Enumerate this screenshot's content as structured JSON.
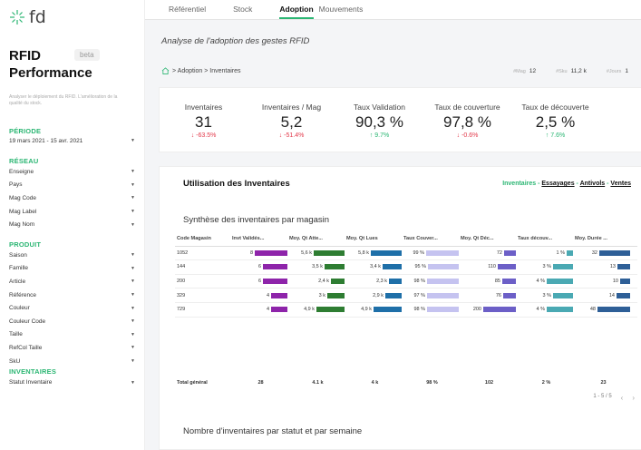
{
  "app": {
    "logo": "fd",
    "title_line1": "RFID",
    "title_line2": "Performance",
    "beta": "beta",
    "description": "Analyser le déploiement du RFID. L'amélioration de la qualité du stock."
  },
  "sidebar": {
    "periode": {
      "title": "PÉRIODE",
      "value": "19 mars 2021 - 15 avr. 2021"
    },
    "reseau": {
      "title": "RÉSEAU",
      "items": [
        "Enseigne",
        "Pays",
        "Mag Code",
        "Mag Label",
        "Mag Nom"
      ]
    },
    "produit": {
      "title": "PRODUIT",
      "items": [
        "Saison",
        "Famille",
        "Article",
        "Référence",
        "Couleur",
        "Couleur Code",
        "Taille",
        "RefCol Taille",
        "SkU"
      ]
    },
    "inventaires": {
      "title": "INVENTAIRES",
      "items": [
        "Statut Inventaire"
      ]
    }
  },
  "tabs": [
    "Référentiel",
    "Stock",
    "Adoption",
    "Mouvements"
  ],
  "subtitle": "Analyse de l'adoption des gestes RFID",
  "breadcrumb": "> Adoption > Inventaires",
  "stats": [
    {
      "label": "#Mag",
      "value": "12"
    },
    {
      "label": "#Sku",
      "value": "11,2 k"
    },
    {
      "label": "#Jours",
      "value": "1"
    }
  ],
  "kpis": [
    {
      "label": "Inventaires",
      "value": "31",
      "delta": "↓ -63.5%",
      "dir": "neg"
    },
    {
      "label": "Inventaires / Mag",
      "value": "5,2",
      "delta": "↓ -51.4%",
      "dir": "neg"
    },
    {
      "label": "Taux Validation",
      "value": "90,3 %",
      "delta": "↑ 9.7%",
      "dir": "pos"
    },
    {
      "label": "Taux de couverture",
      "value": "97,8 %",
      "delta": "↓ -0.6%",
      "dir": "neg"
    },
    {
      "label": "Taux de découverte",
      "value": "2,5 %",
      "delta": "↑ 7.6%",
      "dir": "pos"
    }
  ],
  "panel": {
    "title": "Utilisation des Inventaires",
    "links": {
      "current": "Inventaires",
      "others": [
        "Essayages",
        "Antivols",
        "Ventes"
      ]
    },
    "table_title": "Synthèse des inventaires par magasin",
    "columns": [
      "Code Magasin",
      "Invt Validés...",
      "Moy. Qt Atte...",
      "Moy. Qt Lues",
      "Taux Couver...",
      "Moy. Qt Déc...",
      "Taux découv...",
      "Moy. Durée ..."
    ],
    "bar_colors": [
      "#8e24aa",
      "#2e7d32",
      "#1e6fa8",
      "#c5c3f0",
      "#6c5fc7",
      "#4aa9b3",
      "#2e5f97"
    ],
    "rows": [
      {
        "code": "1052",
        "cells": [
          "8",
          "5,6 k",
          "5,8 k",
          "99 %",
          "72",
          "1 %",
          "32"
        ],
        "fill": [
          1.0,
          0.95,
          0.95,
          1.0,
          0.35,
          0.2,
          0.95
        ]
      },
      {
        "code": "144",
        "cells": [
          "6",
          "3,5 k",
          "3,4 k",
          "95 %",
          "110",
          "3 %",
          "13"
        ],
        "fill": [
          0.75,
          0.6,
          0.58,
          0.95,
          0.55,
          0.6,
          0.4
        ]
      },
      {
        "code": "200",
        "cells": [
          "6",
          "2,4 k",
          "2,3 k",
          "98 %",
          "85",
          "4 %",
          "10"
        ],
        "fill": [
          0.75,
          0.42,
          0.4,
          0.98,
          0.42,
          0.8,
          0.3
        ]
      },
      {
        "code": "329",
        "cells": [
          "4",
          "3 k",
          "2,9 k",
          "97 %",
          "76",
          "3 %",
          "14"
        ],
        "fill": [
          0.5,
          0.52,
          0.5,
          0.97,
          0.38,
          0.6,
          0.43
        ]
      },
      {
        "code": "729",
        "cells": [
          "4",
          "4,9 k",
          "4,9 k",
          "98 %",
          "200",
          "4 %",
          "48"
        ],
        "fill": [
          0.5,
          0.86,
          0.85,
          0.98,
          1.0,
          0.8,
          1.0
        ]
      }
    ],
    "total": [
      "Total général",
      "28",
      "4.1 k",
      "4 k",
      "98 %",
      "102",
      "2 %",
      "23"
    ],
    "pager": "1 - 5 / 5",
    "chart2_title": "Nombre d'inventaires par statut et par semaine"
  }
}
